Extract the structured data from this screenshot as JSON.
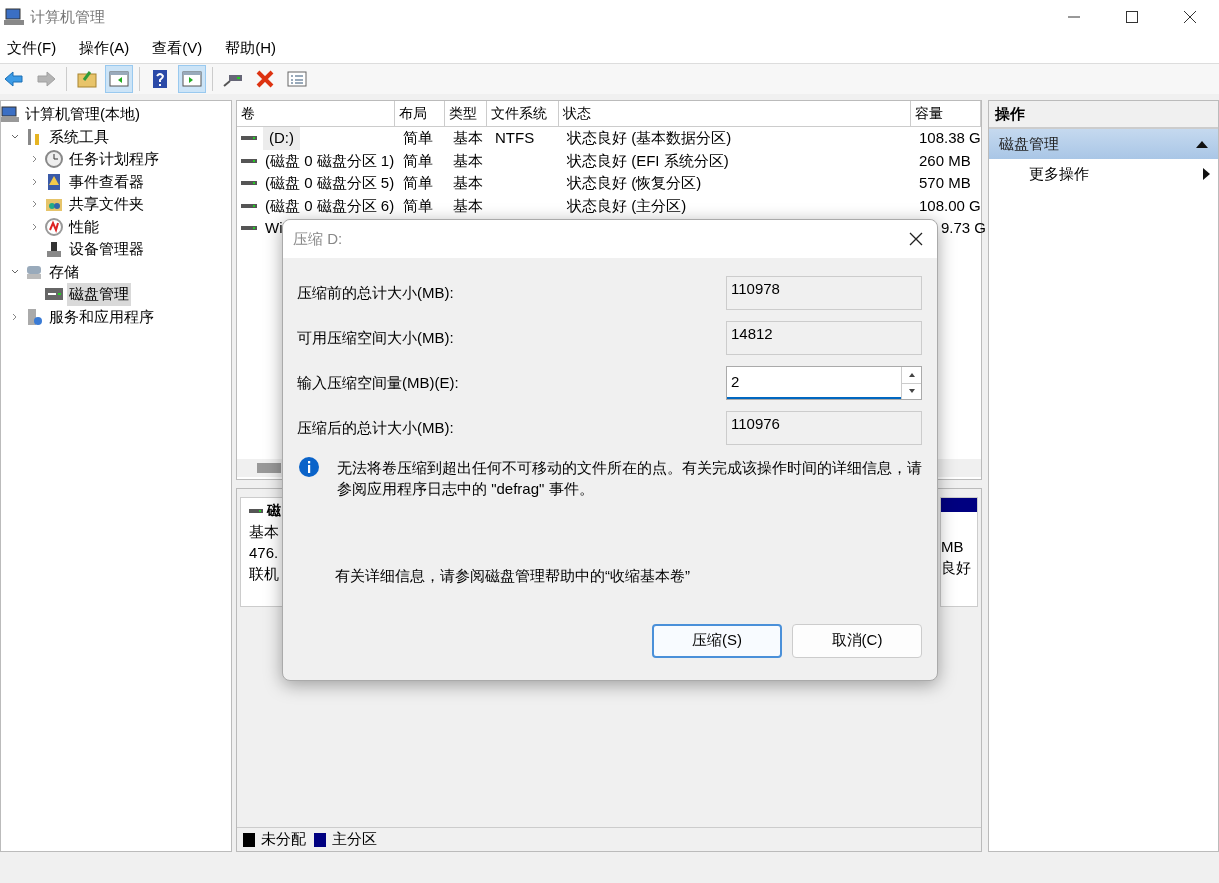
{
  "window": {
    "title": "计算机管理"
  },
  "menu": [
    {
      "label": "文件(F)"
    },
    {
      "label": "操作(A)"
    },
    {
      "label": "查看(V)"
    },
    {
      "label": "帮助(H)"
    }
  ],
  "toolbar": [
    {
      "pressed": false,
      "disabled": false
    },
    {
      "pressed": false,
      "disabled": true
    },
    {
      "pressed": false,
      "disabled": false
    },
    {
      "pressed": true,
      "disabled": false
    },
    {
      "pressed": false,
      "disabled": false
    },
    {
      "pressed": true,
      "disabled": false
    },
    {
      "pressed": false,
      "disabled": false
    },
    {
      "pressed": false,
      "disabled": false
    },
    {
      "pressed": false,
      "disabled": false
    }
  ],
  "tree": [
    {
      "label": "计算机管理(本地)",
      "selected": false,
      "children": [
        {
          "label": "系统工具",
          "selected": false,
          "expanded": true,
          "children": [
            {
              "label": "任务计划程序",
              "selected": false,
              "expanded": false
            },
            {
              "label": "事件查看器",
              "selected": false,
              "expanded": false
            },
            {
              "label": "共享文件夹",
              "selected": false,
              "expanded": false
            },
            {
              "label": "性能",
              "selected": false,
              "expanded": false
            },
            {
              "label": "设备管理器",
              "selected": false
            }
          ]
        },
        {
          "label": "存储",
          "selected": false,
          "expanded": true,
          "children": [
            {
              "label": "磁盘管理",
              "selected": true
            }
          ]
        },
        {
          "label": "服务和应用程序",
          "selected": false,
          "expanded": false
        }
      ]
    }
  ],
  "table": {
    "columns": [
      "卷",
      "布局",
      "类型",
      "文件系统",
      "状态",
      "容量"
    ],
    "rows": [
      {
        "cells": [
          "(D:)",
          "简单",
          "基本",
          "NTFS",
          "状态良好 (基本数据分区)",
          "108.38 G"
        ],
        "selected": true
      },
      {
        "cells": [
          "(磁盘 0 磁盘分区 1)",
          "简单",
          "基本",
          "",
          "状态良好 (EFI 系统分区)",
          "260 MB"
        ],
        "selected": false
      },
      {
        "cells": [
          "(磁盘 0 磁盘分区 5)",
          "简单",
          "基本",
          "",
          "状态良好 (恢复分区)",
          "570 MB"
        ],
        "selected": false
      },
      {
        "cells": [
          "(磁盘 0 磁盘分区 6)",
          "简单",
          "基本",
          "",
          "状态良好 (主分区)",
          "108.00 G"
        ],
        "selected": false
      },
      {
        "cells": [
          "Wi",
          "",
          "",
          "",
          "",
          "9.73 G"
        ],
        "selected": false
      }
    ]
  },
  "disk": {
    "name": "磁",
    "type": "基本",
    "size": "476.",
    "status": "联机",
    "partition_size": "MB",
    "partition_status": "良好"
  },
  "legend": [
    {
      "label": "未分配",
      "color": "#000000"
    },
    {
      "label": "主分区",
      "color": "#000080"
    }
  ],
  "actions": {
    "title": "操作",
    "section": {
      "label": "磁盘管理",
      "expanded": true
    },
    "items": [
      {
        "label": "更多操作"
      }
    ]
  },
  "dialog": {
    "title": "压缩 D:",
    "fields": [
      {
        "label": "压缩前的总计大小(MB):",
        "value": "110978",
        "kind": "readonly"
      },
      {
        "label": "可用压缩空间大小(MB):",
        "value": "14812",
        "kind": "readonly"
      },
      {
        "label": "输入压缩空间量(MB)(E):",
        "value": "2",
        "kind": "spin"
      },
      {
        "label": "压缩后的总计大小(MB):",
        "value": "110976",
        "kind": "readonly"
      }
    ],
    "info": "无法将卷压缩到超出任何不可移动的文件所在的点。有关完成该操作时间的详细信息，请参阅应用程序日志中的 \"defrag\" 事件。",
    "help": "有关详细信息，请参阅磁盘管理帮助中的“收缩基本卷”",
    "buttons": [
      {
        "label": "压缩(S)",
        "default": true
      },
      {
        "label": "取消(C)",
        "default": false
      }
    ]
  }
}
